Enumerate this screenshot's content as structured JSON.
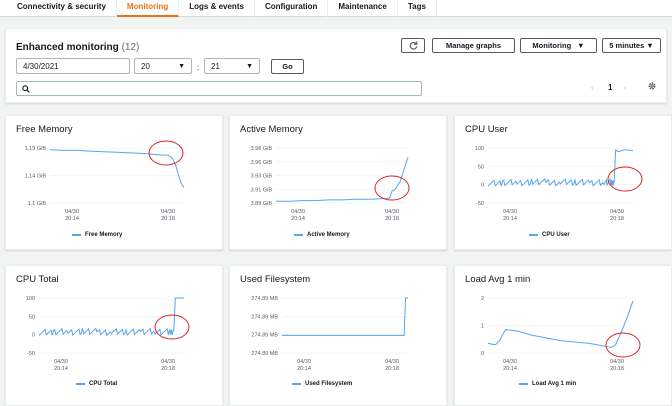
{
  "tabs": [
    {
      "label": "Connectivity & security",
      "active": false
    },
    {
      "label": "Monitoring",
      "active": true
    },
    {
      "label": "Logs & events",
      "active": false
    },
    {
      "label": "Configuration",
      "active": false
    },
    {
      "label": "Maintenance",
      "active": false
    },
    {
      "label": "Tags",
      "active": false
    }
  ],
  "header": {
    "title": "Enhanced monitoring",
    "count": "(12)",
    "refresh_icon": "refresh-icon",
    "manage_graphs_label": "Manage graphs",
    "monitoring_label": "Monitoring",
    "interval_label": "5 minutes",
    "date_value": "4/30/2021",
    "hour_value": "20",
    "minute_value": "21",
    "colon": ":",
    "go_label": "Go",
    "search_placeholder": "",
    "page_number": "1",
    "settings_icon": "gear-icon"
  },
  "colors": {
    "accent": "#ec7211",
    "series": "#5aa4e7",
    "highlight_circle": "#d6262b"
  },
  "chart_data": [
    {
      "type": "line",
      "title": "Free Memory",
      "legend": "Free Memory",
      "yticks": [
        "1.19 GiB",
        "1.14 GiB",
        "1.1 GiB"
      ],
      "ylim": [
        1.1,
        1.19
      ],
      "xticks": [
        [
          "04/30",
          "20:14"
        ],
        [
          "04/30",
          "20:18"
        ]
      ],
      "x": [
        0,
        10,
        20,
        30,
        40,
        50,
        60,
        70,
        80,
        88,
        90,
        92,
        94,
        96,
        98,
        100
      ],
      "values": [
        1.187,
        1.186,
        1.186,
        1.185,
        1.184,
        1.183,
        1.182,
        1.181,
        1.179,
        1.178,
        1.176,
        1.17,
        1.16,
        1.145,
        1.132,
        1.125
      ]
    },
    {
      "type": "line",
      "title": "Active Memory",
      "legend": "Active Memory",
      "yticks": [
        "3.98 GiB",
        "3.96 GiB",
        "3.93 GiB",
        "3.91 GiB",
        "3.89 GiB"
      ],
      "ylim": [
        3.89,
        3.98
      ],
      "xticks": [
        [
          "04/30",
          "20:14"
        ],
        [
          "04/30",
          "20:18"
        ]
      ],
      "x": [
        0,
        10,
        20,
        30,
        40,
        50,
        60,
        70,
        80,
        86,
        88,
        90,
        94,
        97,
        100
      ],
      "values": [
        3.893,
        3.893,
        3.894,
        3.894,
        3.895,
        3.895,
        3.896,
        3.896,
        3.897,
        3.898,
        3.91,
        3.912,
        3.925,
        3.945,
        3.965
      ]
    },
    {
      "type": "line",
      "title": "CPU User",
      "legend": "CPU User",
      "yticks": [
        "100",
        "50",
        "0",
        "-50"
      ],
      "ylim": [
        -50,
        100
      ],
      "xticks": [
        [
          "04/30",
          "20:14"
        ],
        [
          "04/30",
          "20:18"
        ]
      ],
      "x": [
        0,
        10,
        20,
        30,
        40,
        50,
        60,
        70,
        80,
        85,
        87,
        88,
        90,
        94,
        100
      ],
      "values": [
        4,
        6,
        5,
        8,
        5,
        7,
        6,
        5,
        7,
        5,
        8,
        95,
        90,
        95,
        93
      ]
    },
    {
      "type": "line",
      "title": "CPU Total",
      "legend": "CPU Total",
      "yticks": [
        "100",
        "50",
        "0",
        "-50"
      ],
      "ylim": [
        -50,
        100
      ],
      "xticks": [
        [
          "04/30",
          "20:14"
        ],
        [
          "04/30",
          "20:18"
        ]
      ],
      "x": [
        0,
        10,
        20,
        30,
        40,
        50,
        60,
        70,
        80,
        90,
        93,
        94,
        96,
        100
      ],
      "values": [
        6,
        8,
        7,
        9,
        6,
        8,
        7,
        9,
        8,
        7,
        10,
        100,
        100,
        100
      ]
    },
    {
      "type": "line",
      "title": "Used Filesystem",
      "legend": "Used Filesystem",
      "yticks": [
        "274.89 MB",
        "274.89 MB",
        "274.89 MB",
        "274.89 MB"
      ],
      "ylim": [
        0,
        100
      ],
      "xticks": [
        [
          "04/30",
          "20:14"
        ],
        [
          "04/30",
          "20:18"
        ]
      ],
      "x": [
        0,
        50,
        97,
        98,
        100
      ],
      "values": [
        32,
        32,
        32,
        100,
        100
      ]
    },
    {
      "type": "line",
      "title": "Load Avg 1 min",
      "legend": "Load Avg 1 min",
      "yticks": [
        "2",
        "1",
        "0"
      ],
      "ylim": [
        0,
        2
      ],
      "xticks": [
        [
          "04/30",
          "20:14"
        ],
        [
          "04/30",
          "20:18"
        ]
      ],
      "x": [
        0,
        5,
        8,
        12,
        20,
        30,
        40,
        50,
        60,
        70,
        80,
        85,
        88,
        90,
        93,
        96,
        100
      ],
      "values": [
        0.35,
        0.3,
        0.45,
        0.85,
        0.8,
        0.65,
        0.55,
        0.45,
        0.4,
        0.35,
        0.25,
        0.2,
        0.3,
        0.55,
        0.9,
        1.3,
        1.9
      ]
    }
  ]
}
